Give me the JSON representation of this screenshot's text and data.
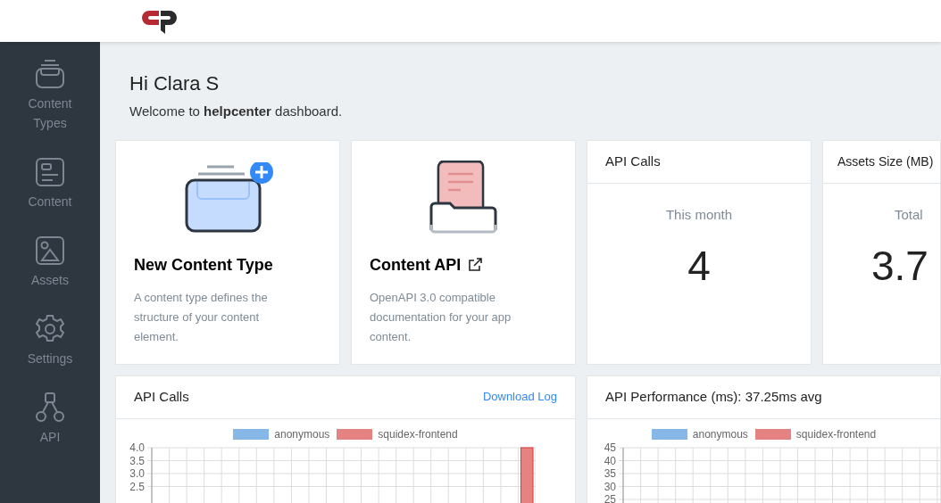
{
  "sidebar": {
    "items": [
      {
        "label": "Content Types",
        "kind": "types",
        "selected": false
      },
      {
        "label": "Content",
        "kind": "content",
        "selected": false
      },
      {
        "label": "Assets",
        "kind": "assets",
        "selected": false
      },
      {
        "label": "Settings",
        "kind": "settings",
        "selected": false
      },
      {
        "label": "API",
        "kind": "api",
        "selected": false
      }
    ]
  },
  "greeting": {
    "title": "Hi Clara S",
    "message": "Welcome to **helpcenter** dashboard."
  },
  "cards": [
    {
      "kind": "create",
      "title": "New Content Type",
      "external": false,
      "description": "A content type defines the structure of your content element."
    },
    {
      "kind": "docs",
      "title": "Content API",
      "external": true,
      "description": "OpenAPI 3.0 compatible documentation for your app content."
    },
    {
      "kind": "stat",
      "title": "API Calls",
      "label": "This month",
      "value": "4"
    },
    {
      "kind": "stat",
      "title": "Assets Size (MB)",
      "label": "Total",
      "value": "3.7"
    }
  ],
  "panels": [
    {
      "title": "API Calls",
      "link": "Download Log",
      "chart_data": {
        "type": "bar",
        "stacked": true,
        "grid": true,
        "ylim": [
          0,
          4
        ],
        "yticks": [
          {
            "value": 4,
            "label": "4.0"
          },
          {
            "value": 3.5,
            "label": "3.5"
          },
          {
            "value": 3,
            "label": "3.0"
          },
          {
            "value": 2.5,
            "label": "2.5"
          }
        ],
        "series": [
          {
            "name": "anonymous",
            "color": "#86b7e6",
            "values": [
              0,
              0,
              0,
              0,
              0,
              0,
              0,
              0,
              0,
              0,
              0,
              0,
              0,
              0,
              0,
              0,
              0,
              0,
              0,
              0,
              0,
              0
            ]
          },
          {
            "name": "squidex-frontend",
            "color": "#e58383",
            "values": [
              0,
              0,
              0,
              0,
              0,
              0,
              0,
              0,
              0,
              0,
              0,
              0,
              0,
              0,
              0,
              0,
              0,
              0,
              0,
              0,
              0,
              4
            ]
          }
        ]
      }
    },
    {
      "title": "API Performance (ms): 37.25ms avg",
      "chart_data": {
        "type": "bar",
        "grid": true,
        "ylim": [
          0,
          45
        ],
        "yticks": [
          45,
          40,
          35,
          30,
          25
        ],
        "series": [
          {
            "name": "anonymous",
            "color": "#86b7e6",
            "values": [
              null,
              null,
              null,
              null,
              null,
              null,
              null,
              null,
              null,
              null,
              null,
              null,
              null,
              null,
              null,
              null,
              null,
              null,
              null,
              null,
              null,
              null
            ]
          },
          {
            "name": "squidex-frontend",
            "color": "#e58383",
            "values": [
              null,
              null,
              null,
              null,
              null,
              null,
              null,
              null,
              null,
              null,
              null,
              null,
              null,
              null,
              null,
              null,
              null,
              null,
              null,
              null,
              null,
              null
            ]
          }
        ]
      }
    }
  ]
}
